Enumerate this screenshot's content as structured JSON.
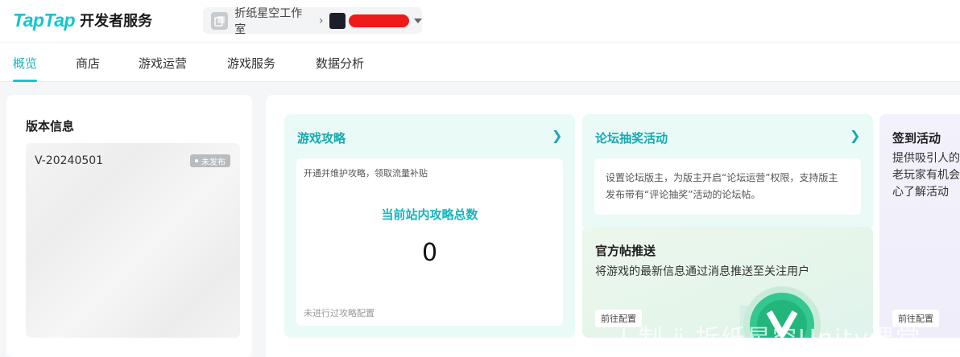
{
  "header": {
    "logo_text": "TapTap",
    "logo_sub": "开发者服务",
    "studio_name": "折纸星空工作室"
  },
  "nav": {
    "tabs": [
      {
        "label": "概览",
        "active": true
      },
      {
        "label": "商店",
        "active": false
      },
      {
        "label": "游戏运营",
        "active": false
      },
      {
        "label": "游戏服务",
        "active": false
      },
      {
        "label": "数据分析",
        "active": false
      }
    ]
  },
  "version": {
    "title": "版本信息",
    "version_no": "V-20240501",
    "status": "未发布"
  },
  "guide": {
    "title": "游戏攻略",
    "desc": "开通并维护攻略，领取流量补贴",
    "stat_label": "当前站内攻略总数",
    "stat_value": "0",
    "footer": "未进行过攻略配置"
  },
  "lottery": {
    "title": "论坛抽奖活动",
    "desc_line1": "设置论坛版主，为版主开启“论坛运营”权限，支持版主",
    "desc_line2": "发布带有“评论抽奖”活动的论坛帖。"
  },
  "push": {
    "title": "官方帖推送",
    "desc": "将游戏的最新信息通过消息推送至关注用户",
    "button": "前往配置"
  },
  "signin": {
    "title": "签到活动",
    "desc_line1": "提供吸引人的",
    "desc_line2": "老玩家有机会",
    "desc_line3": "心了解活动",
    "button": "前往配置"
  },
  "watermark": {
    "text": "Ⅰ 制 ⅱ 折纸星空Unity课堂"
  },
  "colors": {
    "brand": "#15c5ce",
    "brand_dark": "#15a9b2",
    "card_mint": "#e9faf7",
    "card_lavender": "#f3f1fb",
    "redaction": "#ee1b1b"
  }
}
